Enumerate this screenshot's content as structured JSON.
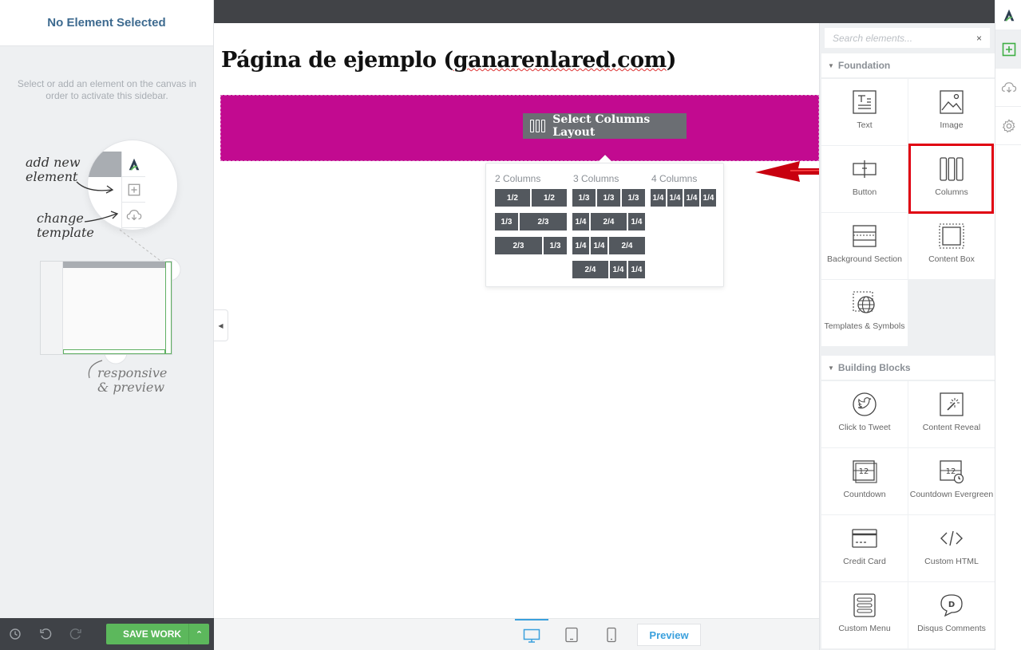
{
  "left_sidebar": {
    "title": "No Element Selected",
    "hint": "Select or add an element on the canvas in order to activate this sidebar.",
    "annotations": {
      "add_new": "add new element",
      "change_template": "change template",
      "responsive": "responsive & preview"
    },
    "footer": {
      "save_label": "SAVE WORK",
      "icons": [
        "history-icon",
        "undo-icon",
        "redo-icon"
      ]
    }
  },
  "canvas": {
    "heading_prefix": "Página de ejemplo (",
    "heading_site": "ganarenlared.com",
    "heading_suffix": ")",
    "section_color": "#c20a90",
    "select_columns_label": "Select Columns Layout",
    "layout_popup": {
      "groups": [
        {
          "title": "2 Columns",
          "rows": [
            [
              "1/2",
              "1/2"
            ],
            [
              "1/3",
              "2/3"
            ],
            [
              "2/3",
              "1/3"
            ]
          ]
        },
        {
          "title": "3 Columns",
          "rows": [
            [
              "1/3",
              "1/3",
              "1/3"
            ],
            [
              "1/4",
              "2/4",
              "1/4"
            ],
            [
              "1/4",
              "1/4",
              "2/4"
            ],
            [
              "2/4",
              "1/4",
              "1/4"
            ]
          ]
        },
        {
          "title": "4 Columns",
          "rows": [
            [
              "1/4",
              "1/4",
              "1/4",
              "1/4"
            ]
          ]
        }
      ]
    },
    "bottom_bar": {
      "devices": [
        "desktop-icon",
        "tablet-icon",
        "mobile-icon"
      ],
      "preview_label": "Preview"
    }
  },
  "elements_panel": {
    "search_placeholder": "Search elements...",
    "sections": [
      {
        "title": "Foundation",
        "items": [
          "Text",
          "Image",
          "Button",
          "Columns",
          "Background Section",
          "Content Box",
          "Templates & Symbols"
        ]
      },
      {
        "title": "Building Blocks",
        "items": [
          "Click to Tweet",
          "Content Reveal",
          "Countdown",
          "Countdown Evergreen",
          "Credit Card",
          "Custom HTML",
          "Custom Menu",
          "Disqus Comments"
        ]
      }
    ],
    "highlighted_item": "Columns"
  },
  "right_rail": {
    "items": [
      "logo-icon",
      "add-element-icon",
      "cloud-download-icon",
      "gear-icon"
    ]
  },
  "colors": {
    "accent_green": "#5cb85c",
    "highlight_red": "#e00012",
    "preview_blue": "#3aa0dd"
  }
}
